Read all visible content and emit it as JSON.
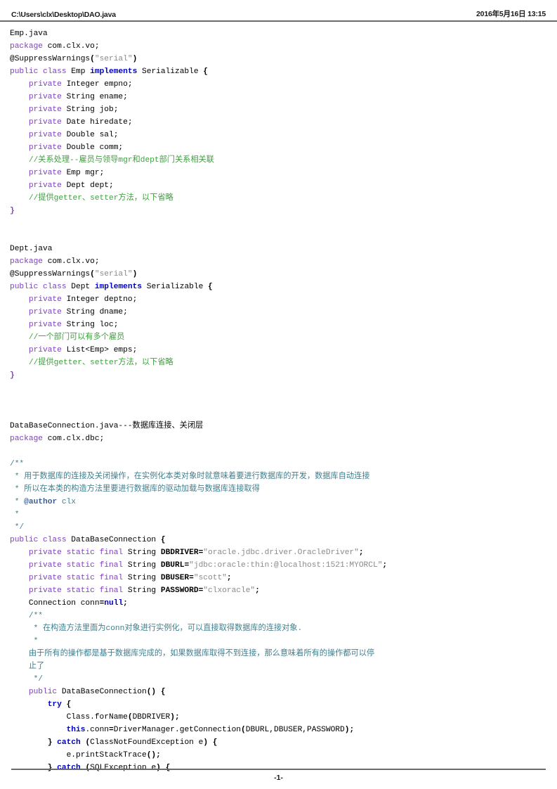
{
  "header": {
    "file_path": "C:\\Users\\clx\\Desktop\\DAO.java",
    "timestamp": "2016年5月16日 13:15"
  },
  "footer": {
    "page_number": "-1-"
  },
  "code_lines": [
    {
      "id": "l001",
      "tokens": [
        {
          "t": "Emp.java",
          "c": "pl"
        }
      ]
    },
    {
      "id": "l002",
      "tokens": [
        {
          "t": "package",
          "c": "kw"
        },
        {
          "t": " com.clx.vo;",
          "c": "pl"
        }
      ]
    },
    {
      "id": "l003",
      "tokens": [
        {
          "t": "@SuppressWarnings",
          "c": "ann"
        },
        {
          "t": "(",
          "c": "plb"
        },
        {
          "t": "\"serial\"",
          "c": "str"
        },
        {
          "t": ")",
          "c": "plb"
        }
      ]
    },
    {
      "id": "l004",
      "tokens": [
        {
          "t": "public class",
          "c": "kw"
        },
        {
          "t": " Emp ",
          "c": "pl"
        },
        {
          "t": "implements",
          "c": "kwb"
        },
        {
          "t": " Serializable ",
          "c": "pl"
        },
        {
          "t": "{",
          "c": "plb"
        }
      ]
    },
    {
      "id": "l005",
      "tokens": [
        {
          "t": "    ",
          "c": "pl"
        },
        {
          "t": "private",
          "c": "kw"
        },
        {
          "t": " Integer empno;",
          "c": "pl"
        }
      ]
    },
    {
      "id": "l006",
      "tokens": [
        {
          "t": "    ",
          "c": "pl"
        },
        {
          "t": "private",
          "c": "kw"
        },
        {
          "t": " String ename;",
          "c": "pl"
        }
      ]
    },
    {
      "id": "l007",
      "tokens": [
        {
          "t": "    ",
          "c": "pl"
        },
        {
          "t": "private",
          "c": "kw"
        },
        {
          "t": " String job;",
          "c": "pl"
        }
      ]
    },
    {
      "id": "l008",
      "tokens": [
        {
          "t": "    ",
          "c": "pl"
        },
        {
          "t": "private",
          "c": "kw"
        },
        {
          "t": " Date hiredate;",
          "c": "pl"
        }
      ]
    },
    {
      "id": "l009",
      "tokens": [
        {
          "t": "    ",
          "c": "pl"
        },
        {
          "t": "private",
          "c": "kw"
        },
        {
          "t": " Double sal;",
          "c": "pl"
        }
      ]
    },
    {
      "id": "l010",
      "tokens": [
        {
          "t": "    ",
          "c": "pl"
        },
        {
          "t": "private",
          "c": "kw"
        },
        {
          "t": " Double comm;",
          "c": "pl"
        }
      ]
    },
    {
      "id": "l011",
      "tokens": [
        {
          "t": "    ",
          "c": "pl"
        },
        {
          "t": "//关系处理--雇员与领导mgr和dept部门关系相关联",
          "c": "cmt"
        }
      ]
    },
    {
      "id": "l012",
      "tokens": [
        {
          "t": "    ",
          "c": "pl"
        },
        {
          "t": "private",
          "c": "kw"
        },
        {
          "t": " Emp mgr;",
          "c": "pl"
        }
      ]
    },
    {
      "id": "l013",
      "tokens": [
        {
          "t": "    ",
          "c": "pl"
        },
        {
          "t": "private",
          "c": "kw"
        },
        {
          "t": " Dept dept;",
          "c": "pl"
        }
      ]
    },
    {
      "id": "l014",
      "tokens": [
        {
          "t": "    ",
          "c": "pl"
        },
        {
          "t": "//提供getter、setter方法，以下省略",
          "c": "cmt"
        }
      ]
    },
    {
      "id": "l015",
      "tokens": [
        {
          "t": "}",
          "c": "brc"
        }
      ]
    },
    {
      "id": "l016",
      "tokens": []
    },
    {
      "id": "l017",
      "tokens": []
    },
    {
      "id": "l018",
      "tokens": [
        {
          "t": "Dept.java",
          "c": "pl"
        }
      ]
    },
    {
      "id": "l019",
      "tokens": [
        {
          "t": "package",
          "c": "kw"
        },
        {
          "t": " com.clx.vo;",
          "c": "pl"
        }
      ]
    },
    {
      "id": "l020",
      "tokens": [
        {
          "t": "@SuppressWarnings",
          "c": "ann"
        },
        {
          "t": "(",
          "c": "plb"
        },
        {
          "t": "\"serial\"",
          "c": "str"
        },
        {
          "t": ")",
          "c": "plb"
        }
      ]
    },
    {
      "id": "l021",
      "tokens": [
        {
          "t": "public class",
          "c": "kw"
        },
        {
          "t": " Dept ",
          "c": "pl"
        },
        {
          "t": "implements",
          "c": "kwb"
        },
        {
          "t": " Serializable ",
          "c": "pl"
        },
        {
          "t": "{",
          "c": "plb"
        }
      ]
    },
    {
      "id": "l022",
      "tokens": [
        {
          "t": "    ",
          "c": "pl"
        },
        {
          "t": "private",
          "c": "kw"
        },
        {
          "t": " Integer deptno;",
          "c": "pl"
        }
      ]
    },
    {
      "id": "l023",
      "tokens": [
        {
          "t": "    ",
          "c": "pl"
        },
        {
          "t": "private",
          "c": "kw"
        },
        {
          "t": " String dname;",
          "c": "pl"
        }
      ]
    },
    {
      "id": "l024",
      "tokens": [
        {
          "t": "    ",
          "c": "pl"
        },
        {
          "t": "private",
          "c": "kw"
        },
        {
          "t": " String loc;",
          "c": "pl"
        }
      ]
    },
    {
      "id": "l025",
      "tokens": [
        {
          "t": "    ",
          "c": "pl"
        },
        {
          "t": "//一个部门可以有多个雇员",
          "c": "cmt"
        }
      ]
    },
    {
      "id": "l026",
      "tokens": [
        {
          "t": "    ",
          "c": "pl"
        },
        {
          "t": "private",
          "c": "kw"
        },
        {
          "t": " List<Emp> emps;",
          "c": "pl"
        }
      ]
    },
    {
      "id": "l027",
      "tokens": [
        {
          "t": "    ",
          "c": "pl"
        },
        {
          "t": "//提供getter、setter方法，以下省略",
          "c": "cmt"
        }
      ]
    },
    {
      "id": "l028",
      "tokens": [
        {
          "t": "}",
          "c": "brc"
        }
      ]
    },
    {
      "id": "l029",
      "tokens": []
    },
    {
      "id": "l030",
      "tokens": []
    },
    {
      "id": "l031",
      "tokens": []
    },
    {
      "id": "l032",
      "tokens": [
        {
          "t": "DataBaseConnection.java---数据库连接、关闭层",
          "c": "pl"
        }
      ]
    },
    {
      "id": "l033",
      "tokens": [
        {
          "t": "package",
          "c": "kw"
        },
        {
          "t": " com.clx.dbc;",
          "c": "pl"
        }
      ]
    },
    {
      "id": "l034",
      "tokens": []
    },
    {
      "id": "l035",
      "tokens": [
        {
          "t": "/**",
          "c": "doc"
        }
      ]
    },
    {
      "id": "l036",
      "tokens": [
        {
          "t": " * 用于数据库的连接及关闭操作，在实例化本类对象时就意味着要进行数据库的开发，数据库自动连接",
          "c": "doc"
        }
      ]
    },
    {
      "id": "l037",
      "tokens": [
        {
          "t": " * 所以在本类的构造方法里要进行数据库的驱动加载与数据库连接取得",
          "c": "doc"
        }
      ]
    },
    {
      "id": "l038",
      "tokens": [
        {
          "t": " * ",
          "c": "doc"
        },
        {
          "t": "@author",
          "c": "docb"
        },
        {
          "t": " clx",
          "c": "doc"
        }
      ]
    },
    {
      "id": "l039",
      "tokens": [
        {
          "t": " *",
          "c": "doc"
        }
      ]
    },
    {
      "id": "l040",
      "tokens": [
        {
          "t": " */",
          "c": "doc"
        }
      ]
    },
    {
      "id": "l041",
      "tokens": [
        {
          "t": "public class",
          "c": "kw"
        },
        {
          "t": " DataBaseConnection ",
          "c": "pl"
        },
        {
          "t": "{",
          "c": "plb"
        }
      ]
    },
    {
      "id": "l042",
      "tokens": [
        {
          "t": "    ",
          "c": "pl"
        },
        {
          "t": "private static final",
          "c": "kw"
        },
        {
          "t": " String ",
          "c": "pl"
        },
        {
          "t": "DBDRIVER",
          "c": "plb"
        },
        {
          "t": "=",
          "c": "plb"
        },
        {
          "t": "\"oracle.jdbc.driver.OracleDriver\"",
          "c": "str"
        },
        {
          "t": ";",
          "c": "plb"
        }
      ]
    },
    {
      "id": "l043",
      "tokens": [
        {
          "t": "    ",
          "c": "pl"
        },
        {
          "t": "private static final",
          "c": "kw"
        },
        {
          "t": " String ",
          "c": "pl"
        },
        {
          "t": "DBURL",
          "c": "plb"
        },
        {
          "t": "=",
          "c": "plb"
        },
        {
          "t": "\"jdbc:oracle:thin:@localhost:1521:MYORCL\"",
          "c": "str"
        },
        {
          "t": ";",
          "c": "plb"
        }
      ]
    },
    {
      "id": "l044",
      "tokens": [
        {
          "t": "    ",
          "c": "pl"
        },
        {
          "t": "private static final",
          "c": "kw"
        },
        {
          "t": " String ",
          "c": "pl"
        },
        {
          "t": "DBUSER",
          "c": "plb"
        },
        {
          "t": "=",
          "c": "plb"
        },
        {
          "t": "\"scott\"",
          "c": "str"
        },
        {
          "t": ";",
          "c": "plb"
        }
      ]
    },
    {
      "id": "l045",
      "tokens": [
        {
          "t": "    ",
          "c": "pl"
        },
        {
          "t": "private static final",
          "c": "kw"
        },
        {
          "t": " String ",
          "c": "pl"
        },
        {
          "t": "PASSWORD",
          "c": "plb"
        },
        {
          "t": "=",
          "c": "plb"
        },
        {
          "t": "\"clxoracle\"",
          "c": "str"
        },
        {
          "t": ";",
          "c": "plb"
        }
      ]
    },
    {
      "id": "l046",
      "tokens": [
        {
          "t": "    ",
          "c": "pl"
        },
        {
          "t": "Connection conn",
          "c": "pl"
        },
        {
          "t": "=",
          "c": "plb"
        },
        {
          "t": "null",
          "c": "kwb"
        },
        {
          "t": ";",
          "c": "plb"
        }
      ]
    },
    {
      "id": "l047",
      "tokens": [
        {
          "t": "    /**",
          "c": "doc"
        }
      ]
    },
    {
      "id": "l048",
      "tokens": [
        {
          "t": "     * 在构造方法里面为conn对象进行实例化，可以直接取得数据库的连接对象.",
          "c": "doc"
        }
      ]
    },
    {
      "id": "l049",
      "tokens": [
        {
          "t": "     *",
          "c": "doc"
        }
      ]
    },
    {
      "id": "l050",
      "tokens": [
        {
          "t": "    由于所有的操作都是基于数据库完成的，如果数据库取得不到连接，那么意味着所有的操作都可以停",
          "c": "doc"
        }
      ]
    },
    {
      "id": "l051",
      "tokens": [
        {
          "t": "    止了",
          "c": "doc"
        }
      ]
    },
    {
      "id": "l052",
      "tokens": [
        {
          "t": "     */",
          "c": "doc"
        }
      ]
    },
    {
      "id": "l053",
      "tokens": [
        {
          "t": "    ",
          "c": "pl"
        },
        {
          "t": "public",
          "c": "kw"
        },
        {
          "t": " DataBaseConnection",
          "c": "pl"
        },
        {
          "t": "()",
          "c": "plb"
        },
        {
          "t": " ",
          "c": "pl"
        },
        {
          "t": "{",
          "c": "plb"
        }
      ]
    },
    {
      "id": "l054",
      "tokens": [
        {
          "t": "        ",
          "c": "pl"
        },
        {
          "t": "try",
          "c": "kwb"
        },
        {
          "t": " ",
          "c": "pl"
        },
        {
          "t": "{",
          "c": "plb"
        }
      ]
    },
    {
      "id": "l055",
      "tokens": [
        {
          "t": "            Class.forName",
          "c": "pl"
        },
        {
          "t": "(",
          "c": "plb"
        },
        {
          "t": "DBDRIVER",
          "c": "pl"
        },
        {
          "t": ");",
          "c": "plb"
        }
      ]
    },
    {
      "id": "l056",
      "tokens": [
        {
          "t": "            ",
          "c": "pl"
        },
        {
          "t": "this",
          "c": "kwb"
        },
        {
          "t": ".conn",
          "c": "pl"
        },
        {
          "t": "=",
          "c": "plb"
        },
        {
          "t": "DriverManager.getConnection",
          "c": "pl"
        },
        {
          "t": "(",
          "c": "plb"
        },
        {
          "t": "DBURL,DBUSER,PASSWORD",
          "c": "pl"
        },
        {
          "t": ");",
          "c": "plb"
        }
      ]
    },
    {
      "id": "l057",
      "tokens": [
        {
          "t": "        ",
          "c": "pl"
        },
        {
          "t": "}",
          "c": "plb"
        },
        {
          "t": " ",
          "c": "pl"
        },
        {
          "t": "catch",
          "c": "kwb"
        },
        {
          "t": " ",
          "c": "pl"
        },
        {
          "t": "(",
          "c": "plb"
        },
        {
          "t": "ClassNotFoundException e",
          "c": "pl"
        },
        {
          "t": ")",
          "c": "plb"
        },
        {
          "t": " ",
          "c": "pl"
        },
        {
          "t": "{",
          "c": "plb"
        }
      ]
    },
    {
      "id": "l058",
      "tokens": [
        {
          "t": "            e.printStackTrace",
          "c": "pl"
        },
        {
          "t": "();",
          "c": "plb"
        }
      ]
    },
    {
      "id": "l059",
      "tokens": [
        {
          "t": "        ",
          "c": "pl"
        },
        {
          "t": "}",
          "c": "plb"
        },
        {
          "t": " ",
          "c": "pl"
        },
        {
          "t": "catch",
          "c": "kwb"
        },
        {
          "t": " ",
          "c": "pl"
        },
        {
          "t": "(",
          "c": "plb"
        },
        {
          "t": "SQLException e",
          "c": "pl"
        },
        {
          "t": ")",
          "c": "plb"
        },
        {
          "t": " ",
          "c": "pl"
        },
        {
          "t": "{",
          "c": "plb"
        }
      ]
    }
  ]
}
